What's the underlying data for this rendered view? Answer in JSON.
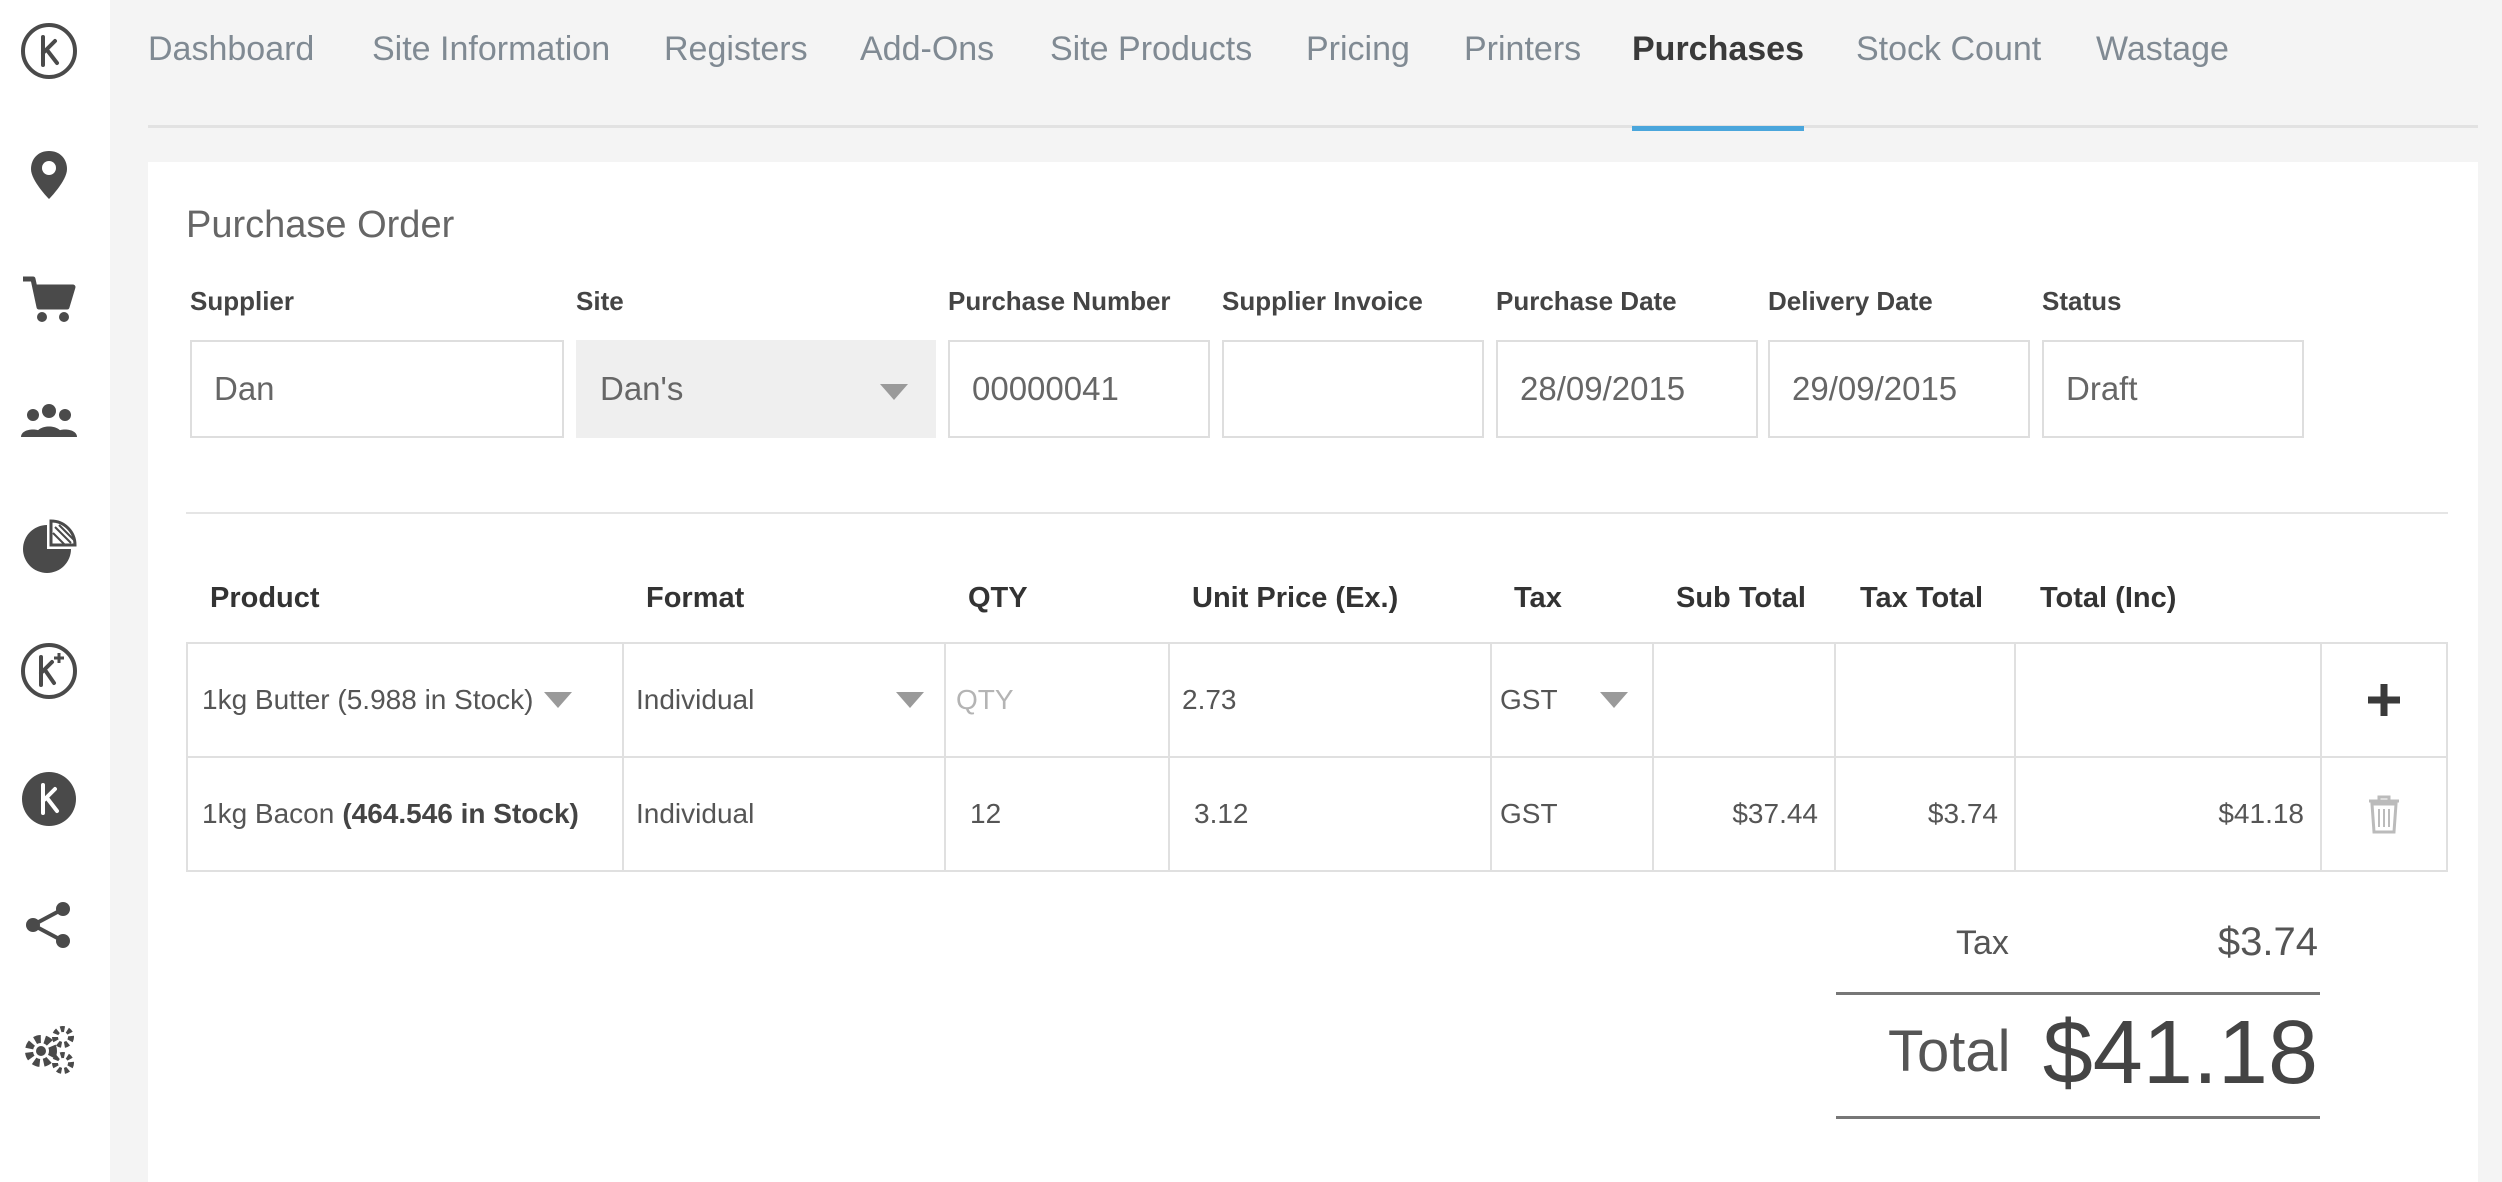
{
  "nav": {
    "tabs": [
      {
        "label": "Dashboard"
      },
      {
        "label": "Site Information"
      },
      {
        "label": "Registers"
      },
      {
        "label": "Add-Ons"
      },
      {
        "label": "Site Products"
      },
      {
        "label": "Pricing"
      },
      {
        "label": "Printers"
      },
      {
        "label": "Purchases"
      },
      {
        "label": "Stock Count"
      },
      {
        "label": "Wastage"
      }
    ],
    "active": "Purchases"
  },
  "sidebar": {
    "icons": [
      "k-logo-icon",
      "location-pin-icon",
      "cart-icon",
      "users-icon",
      "pie-chart-icon",
      "k-plus-icon",
      "k-badge-icon",
      "share-icon",
      "gears-icon"
    ]
  },
  "purchase_order": {
    "title": "Purchase Order",
    "fields": {
      "supplier": {
        "label": "Supplier",
        "value": "Dan"
      },
      "site": {
        "label": "Site",
        "value": "Dan's"
      },
      "purchase_number": {
        "label": "Purchase Number",
        "value": "00000041"
      },
      "supplier_invoice": {
        "label": "Supplier Invoice",
        "value": ""
      },
      "purchase_date": {
        "label": "Purchase Date",
        "value": "28/09/2015"
      },
      "delivery_date": {
        "label": "Delivery Date",
        "value": "29/09/2015"
      },
      "status": {
        "label": "Status",
        "value": "Draft"
      }
    }
  },
  "table": {
    "headers": {
      "product": "Product",
      "format": "Format",
      "qty": "QTY",
      "unit_price": "Unit Price (Ex.)",
      "tax": "Tax",
      "sub_total": "Sub Total",
      "tax_total": "Tax Total",
      "total_inc": "Total (Inc)"
    },
    "new_row": {
      "product": "1kg Butter (5.988 in Stock)",
      "format": "Individual",
      "qty_placeholder": "QTY",
      "unit_price": "2.73",
      "tax": "GST"
    },
    "rows": [
      {
        "product_name": "1kg Bacon",
        "product_stock": "(464.546 in Stock)",
        "format": "Individual",
        "qty": "12",
        "unit_price": "3.12",
        "tax": "GST",
        "sub_total": "$37.44",
        "tax_total": "$3.74",
        "total_inc": "$41.18"
      }
    ]
  },
  "totals": {
    "tax_label": "Tax",
    "tax_value": "$3.74",
    "total_label": "Total",
    "total_value": "$41.18"
  }
}
